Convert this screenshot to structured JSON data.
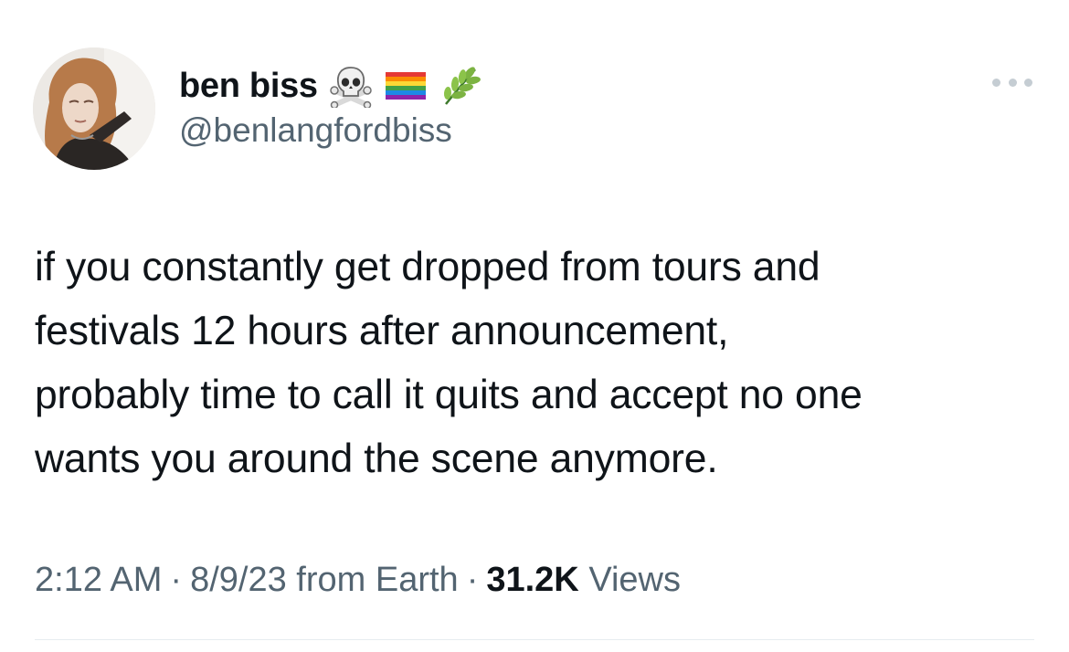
{
  "author": {
    "display_name": "ben biss",
    "handle": "@benlangfordbiss",
    "name_emojis": [
      "skull-crossbones-icon",
      "rainbow-flag-icon",
      "herb-icon"
    ]
  },
  "tweet": {
    "text_lines": [
      "if you constantly get dropped from tours and",
      "festivals 12 hours after announcement,",
      "probably time to call it quits and accept no one",
      "wants you around the scene anymore."
    ]
  },
  "meta": {
    "time": "2:12 AM",
    "date": "8/9/23",
    "source": "from Earth",
    "separator": "·",
    "views_count": "31.2K",
    "views_label": "Views"
  },
  "colors": {
    "text_primary": "#0f1419",
    "text_secondary": "#536471",
    "divider": "#e6ecf0"
  }
}
